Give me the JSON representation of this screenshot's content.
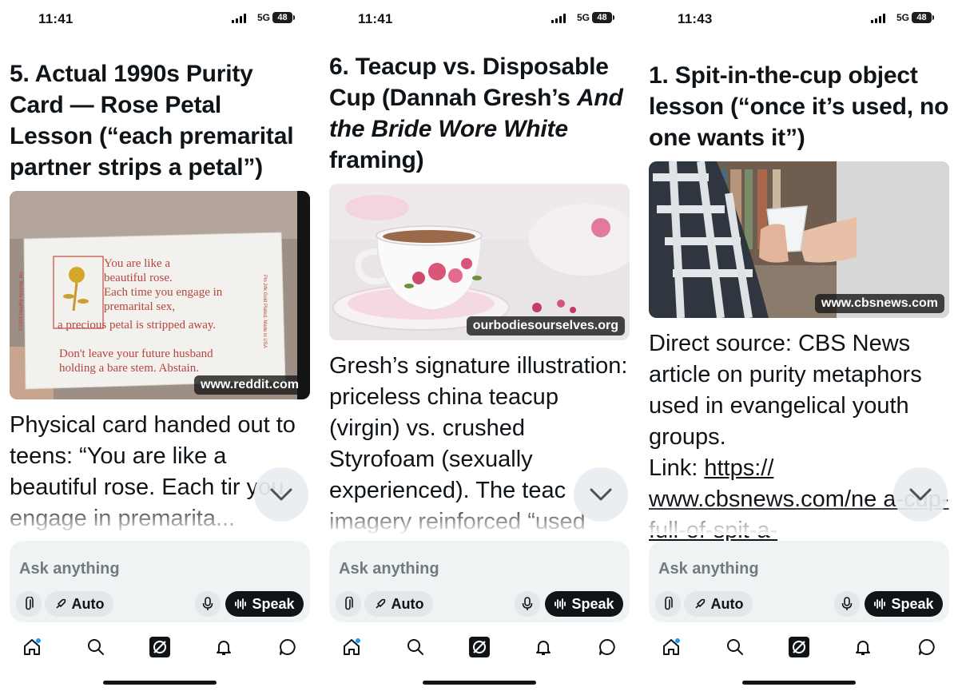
{
  "colors": {
    "text": "#0f1419",
    "ask_bg": "#eff3f4",
    "speak_bg": "#0f1419",
    "notification_dot": "#1d9bf0"
  },
  "screens": [
    {
      "status": {
        "time": "11:41",
        "network": "5G",
        "battery": "48"
      },
      "heading_parts": [
        "5. Actual 1990s Purity Card — Rose Petal Lesson (“each premarital partner strips a petal”)"
      ],
      "image": {
        "source_label": "www.reddit.com",
        "card_lines": [
          "You are like a",
          "beautiful rose.",
          "Each time you engage in",
          "premarital sex,",
          "a precious petal is stripped away.",
          "Don't leave your future husband",
          "holding a bare stem. Abstain."
        ],
        "card_side_left": "©1993 Healthy Nursing, Inc.",
        "card_side_right": "Pin 24k Gold Plated. Made in USA"
      },
      "body": "Physical card handed out to teens: “You are like a beautiful rose. Each tir you engage in premarita..."
    },
    {
      "status": {
        "time": "11:41",
        "network": "5G",
        "battery": "48"
      },
      "heading_parts": [
        "6. Teacup vs. Disposable Cup (Dannah Gresh’s ",
        "And the Bride Wore White",
        " framing)"
      ],
      "image": {
        "source_label": "ourbodiesourselves.org"
      },
      "body": "Gresh’s signature illustration: priceless china teacup (virgin) vs. crushed Styrofoam (sexually experienced). The teac imagery reinforced “used"
    },
    {
      "status": {
        "time": "11:43",
        "network": "5G",
        "battery": "48"
      },
      "heading_parts": [
        "1. Spit-in-the-cup object lesson (“once it’s used, no one wants it”)"
      ],
      "image": {
        "source_label": "www.cbsnews.com"
      },
      "body": "Direct source: CBS News article on purity metaphors used in evangelical youth groups.",
      "link_label": "Link: ",
      "link_text": "https:// www.cbsnews.com/ne a-cup-full-of-spit-a-"
    }
  ],
  "ask": {
    "placeholder": "Ask anything",
    "auto_label": "Auto",
    "speak_label": "Speak"
  },
  "nav": {
    "icons": [
      "home-icon",
      "search-icon",
      "grok-icon",
      "bell-icon",
      "messages-icon"
    ]
  }
}
